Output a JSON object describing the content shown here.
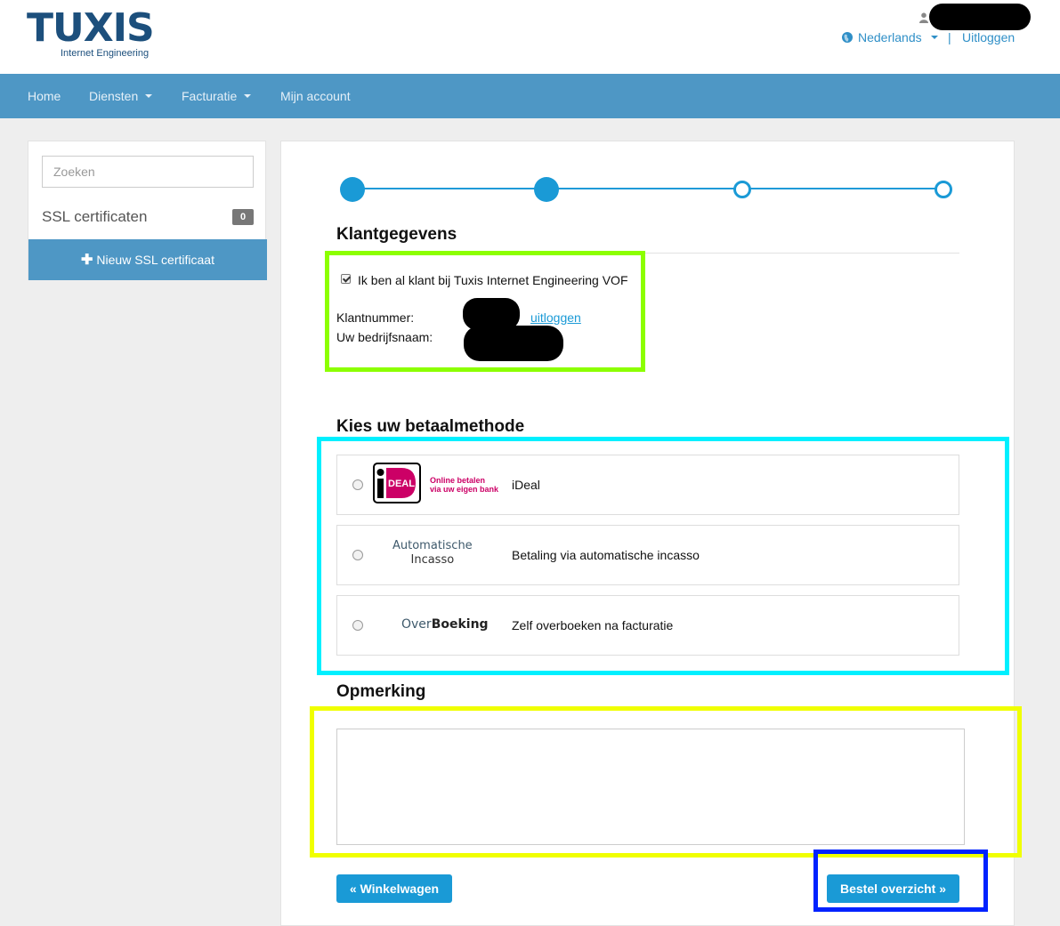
{
  "header": {
    "logo_text": "TUXIS",
    "logo_tagline": "Internet Engineering",
    "language_label": "Nederlands",
    "separator": "|",
    "logout_label": "Uitloggen"
  },
  "nav": {
    "items": [
      {
        "label": "Home",
        "dropdown": false
      },
      {
        "label": "Diensten",
        "dropdown": true
      },
      {
        "label": "Facturatie",
        "dropdown": true
      },
      {
        "label": "Mijn account",
        "dropdown": false
      }
    ]
  },
  "sidebar": {
    "search_placeholder": "Zoeken",
    "category_label": "SSL certificaten",
    "category_count": "0",
    "new_button_label": "Nieuw SSL certificaat"
  },
  "steps": {
    "total": 4,
    "completed": 2
  },
  "customer": {
    "heading": "Klantgegevens",
    "existing_checkbox_label": "Ik ben al klant bij Tuxis Internet Engineering VOF",
    "existing_checked": true,
    "customer_number_label": "Klantnummer:",
    "company_name_label": "Uw bedrijfsnaam:",
    "logout_link": "uitloggen"
  },
  "payment": {
    "heading": "Kies uw betaalmethode",
    "methods": [
      {
        "logo": "iD EAL",
        "logo_tagline_1": "Online betalen",
        "logo_tagline_2": "via uw eigen bank",
        "label": "iDeal"
      },
      {
        "logo_line1": "Automatische",
        "logo_line2": "Incasso",
        "label": "Betaling via automatische incasso"
      },
      {
        "logo_part1": "Over",
        "logo_part2": "Boeking",
        "label": "Zelf overboeken na facturatie"
      }
    ]
  },
  "remark": {
    "heading": "Opmerking",
    "value": ""
  },
  "actions": {
    "back_label": "« Winkelwagen",
    "next_label": "Bestel overzicht »"
  },
  "colors": {
    "primary": "#1a9ad6",
    "navbar": "#4e97c5",
    "highlight_customer": "#8cff00",
    "highlight_payment": "#00f0ff",
    "highlight_remark": "#f0ff00",
    "highlight_button": "#0022ff"
  }
}
